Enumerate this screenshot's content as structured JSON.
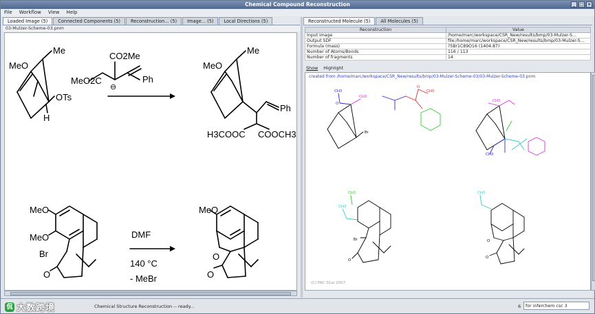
{
  "window": {
    "title": "Chemical Compound Reconstruction",
    "buttons": [
      "_",
      "□",
      "×"
    ]
  },
  "menu": [
    "File",
    "Workflow",
    "View",
    "Help"
  ],
  "left": {
    "tabs": [
      "Loaded Image (5)",
      "Connected Components (5)",
      "Reconstruction... (5)",
      "Image... (5)",
      "Local Directions (5)"
    ],
    "active_tab": 0,
    "file_label": "03-Mulzer-Scheme-03.pnm",
    "scheme": {
      "r1_substituent_ome": "MeO",
      "r1_substituent_me": "Me",
      "r1_ots": "OTs",
      "r1_h": "H",
      "reagent_co2me": "CO2Me",
      "reagent_meo2c": "MeO2C",
      "reagent_ph": "Ph",
      "reagent_charge": "⊖",
      "p1_ome": "MeO",
      "p1_me": "Me",
      "p1_ph": "Ph",
      "p1_h3cooc": "H3COOC",
      "p1_cooch3": "COOCH3",
      "r2_meo1": "MeO",
      "r2_meo2": "MeO",
      "r2_br": "Br",
      "r2_o": "O",
      "cond_solvent": "DMF",
      "cond_temp": "140 °C",
      "cond_loss": "- MeBr",
      "p2_meo": "MeO",
      "p2_o1": "O",
      "p2_o2": "O"
    }
  },
  "right": {
    "tabs": [
      "Reconstructed Molecule (5)",
      "All Molecules (5)"
    ],
    "active_tab": 0,
    "table_headers": [
      "Reconstruction",
      "Value"
    ],
    "table_rows": [
      [
        "Input image",
        "/home/marc/workspace/CSR_New/results/bmp/03-Mulzer-S..."
      ],
      [
        "Output SDF",
        "file:/home/marc/workspace/CSR_New/results/bmp/03-Mulzer-S..."
      ],
      [
        "Formula (mass)",
        "?5Br1C89O16 (1404.87)"
      ],
      [
        "Number of Atoms/Bonds",
        "116 / 113"
      ],
      [
        "Number of fragments",
        "14"
      ]
    ],
    "subtabs": [
      "Show",
      "Highlight"
    ],
    "created": "created from /home/marc/workspace/CSR_New/results/bmp/03-Mulzer-Scheme-03/03-Mulzer-Scheme-03.pnm",
    "copyright": "(C) PAC SCai 2007",
    "labels": {
      "ch3": "CH3",
      "o": "O",
      "br": "Br"
    }
  },
  "status": {
    "text": "Chemical Structure Reconstruction -- ready...",
    "count": "6",
    "field": "for inferchem csc 3"
  },
  "watermark": {
    "logo": "侃",
    "text": "大数跨境"
  },
  "colors": {
    "title_bg": "#4e6790",
    "link": "#3344bb",
    "mol_red": "#e03030",
    "mol_blue": "#2a2ad0",
    "mol_green": "#33cc33",
    "mol_magenta": "#dd33dd",
    "mol_cyan": "#33cccc"
  }
}
